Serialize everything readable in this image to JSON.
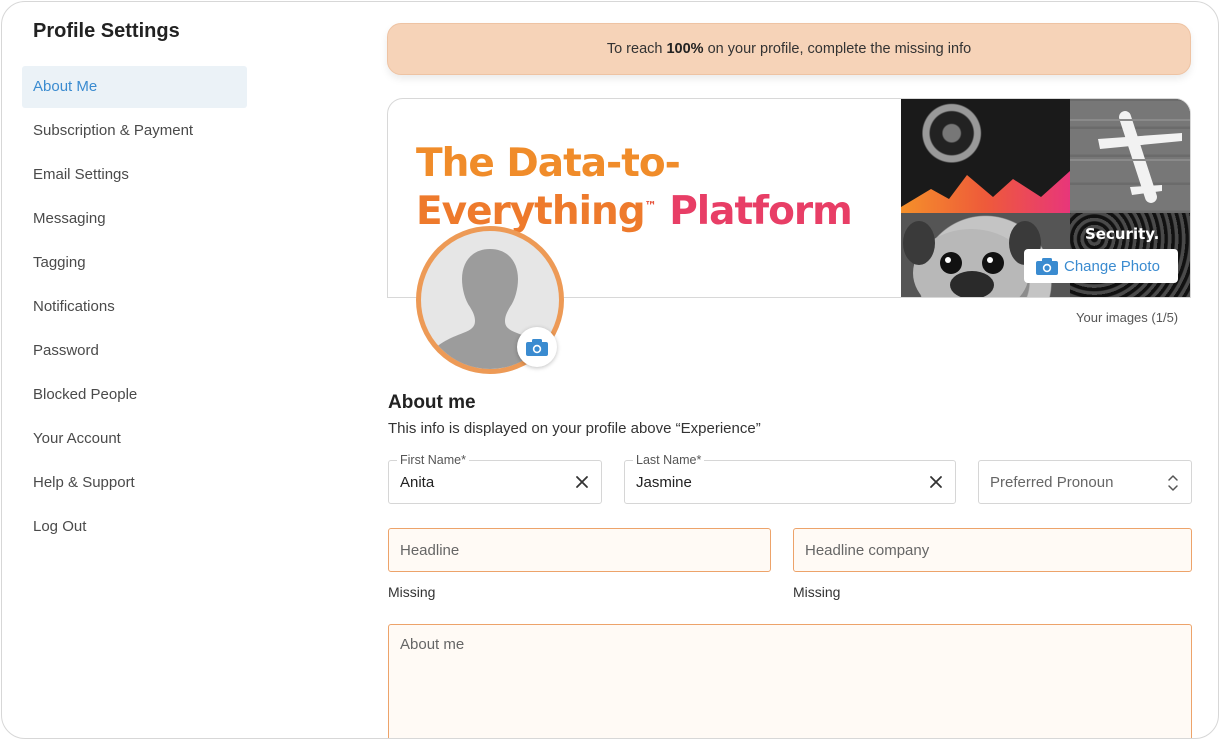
{
  "sidebar": {
    "title": "Profile Settings",
    "items": [
      {
        "label": "About Me",
        "active": true
      },
      {
        "label": "Subscription & Payment"
      },
      {
        "label": "Email Settings"
      },
      {
        "label": "Messaging"
      },
      {
        "label": "Tagging"
      },
      {
        "label": "Notifications"
      },
      {
        "label": "Password"
      },
      {
        "label": "Blocked People"
      },
      {
        "label": "Your Account"
      },
      {
        "label": "Help & Support"
      },
      {
        "label": "Log Out"
      }
    ]
  },
  "alert": {
    "prefix": "To reach ",
    "highlight": "100%",
    "suffix": " on your profile, complete the missing info"
  },
  "cover": {
    "headline_line1": "The Data-to-",
    "headline_line2a": "Everything",
    "headline_tm": "™",
    "headline_line2b": " Platform",
    "collage_text": "Security.",
    "change_photo_label": "Change Photo",
    "images_count": "Your images (1/5)"
  },
  "about": {
    "title": "About me",
    "subtitle": "This info is displayed on your profile above “Experience”",
    "first_name_label": "First Name*",
    "first_name_value": "Anita",
    "last_name_label": "Last Name*",
    "last_name_value": "Jasmine",
    "pronoun_placeholder": "Preferred Pronoun",
    "headline_placeholder": "Headline",
    "headline_status": "Missing",
    "headline_company_placeholder": "Headline company",
    "headline_company_status": "Missing",
    "about_placeholder": "About me"
  },
  "colors": {
    "accent_blue": "#3a8bd0",
    "alert_bg": "#f6d3b8",
    "avatar_ring": "#ed9a56",
    "missing_border": "#eda36a"
  }
}
